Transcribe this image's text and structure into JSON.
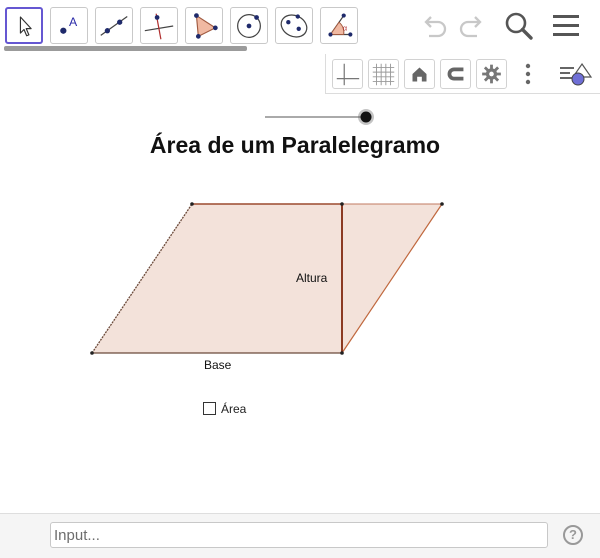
{
  "toolbar": {
    "tools": [
      {
        "name": "move",
        "icon": "cursor-arrow-icon",
        "active": true
      },
      {
        "name": "point",
        "icon": "point-icon",
        "label": "A"
      },
      {
        "name": "line",
        "icon": "line-through-points-icon"
      },
      {
        "name": "perpendicular",
        "icon": "perpendicular-line-icon"
      },
      {
        "name": "polygon",
        "icon": "polygon-icon"
      },
      {
        "name": "circle",
        "icon": "circle-center-point-icon"
      },
      {
        "name": "ellipse",
        "icon": "ellipse-icon"
      },
      {
        "name": "angle",
        "icon": "angle-icon",
        "label": "α"
      }
    ],
    "actions": [
      "undo-icon",
      "redo-icon",
      "search-icon",
      "menu-icon"
    ]
  },
  "stylebar": [
    "axes-icon",
    "grid-icon",
    "home-icon",
    "magnet-icon",
    "settings-icon",
    "more-icon",
    "style-bar-toggle-icon"
  ],
  "graphics": {
    "title": "Área de um Paralelegramo",
    "labels": {
      "height": "Altura",
      "base": "Base"
    },
    "checkbox": {
      "label": "Área",
      "checked": false
    },
    "slider": {
      "value": 1.0
    },
    "fill_color": "#f3e2da",
    "edge_color": "#9b4a2e"
  },
  "input_bar": {
    "placeholder": "Input...",
    "value": ""
  },
  "colors": {
    "accent": "#6557d2",
    "point": "#1f2a6b"
  }
}
